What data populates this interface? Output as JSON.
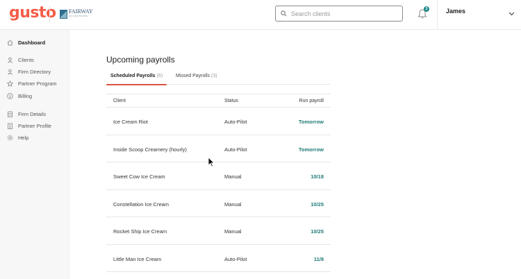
{
  "header": {
    "logo_text": "gusto",
    "partner_logo": {
      "name": "FAIRWAY",
      "tagline": "ACCOUNTING"
    },
    "search": {
      "placeholder": "Search clients",
      "value": ""
    },
    "notifications": {
      "count": "3"
    },
    "user": {
      "name": "James"
    }
  },
  "sidebar": {
    "items": [
      {
        "label": "Dashboard",
        "icon": "home-icon",
        "active": true
      },
      {
        "label": "Clients",
        "icon": "person-icon"
      },
      {
        "label": "Firm Directory",
        "icon": "person-icon"
      },
      {
        "label": "Partner Program",
        "icon": "star-icon"
      },
      {
        "label": "Billing",
        "icon": "dollar-icon"
      },
      {
        "label": "Firm Details",
        "icon": "building-icon"
      },
      {
        "label": "Partner Profile",
        "icon": "profile-card-icon"
      },
      {
        "label": "Help",
        "icon": "gear-icon"
      }
    ]
  },
  "main": {
    "title": "Upcoming payrolls",
    "tabs": [
      {
        "label": "Scheduled Payrolls",
        "count": "(6)",
        "active": true
      },
      {
        "label": "Missed Payrolls",
        "count": "(3)"
      }
    ],
    "table": {
      "headers": {
        "client": "Client",
        "status": "Status",
        "run": "Run payroll"
      },
      "rows": [
        {
          "client": "Ice Cream Riot",
          "status": "Auto-Pilot",
          "run": "Tomorrow"
        },
        {
          "client": "Inside Scoop Creamery (hourly)",
          "status": "Auto-Pilot",
          "run": "Tomorrow"
        },
        {
          "client": "Sweet Cow Ice Cream",
          "status": "Manual",
          "run": "10/18"
        },
        {
          "client": "Constellation Ice Cream",
          "status": "Manual",
          "run": "10/25"
        },
        {
          "client": "Rocket Ship Ice Cream",
          "status": "Manual",
          "run": "10/25"
        },
        {
          "client": "Little Man Ice Cream",
          "status": "Auto-Pilot",
          "run": "11/8"
        }
      ]
    }
  },
  "colors": {
    "brand": "#f45d48",
    "tab_underline": "#d9533f",
    "link": "#1f7a75"
  }
}
